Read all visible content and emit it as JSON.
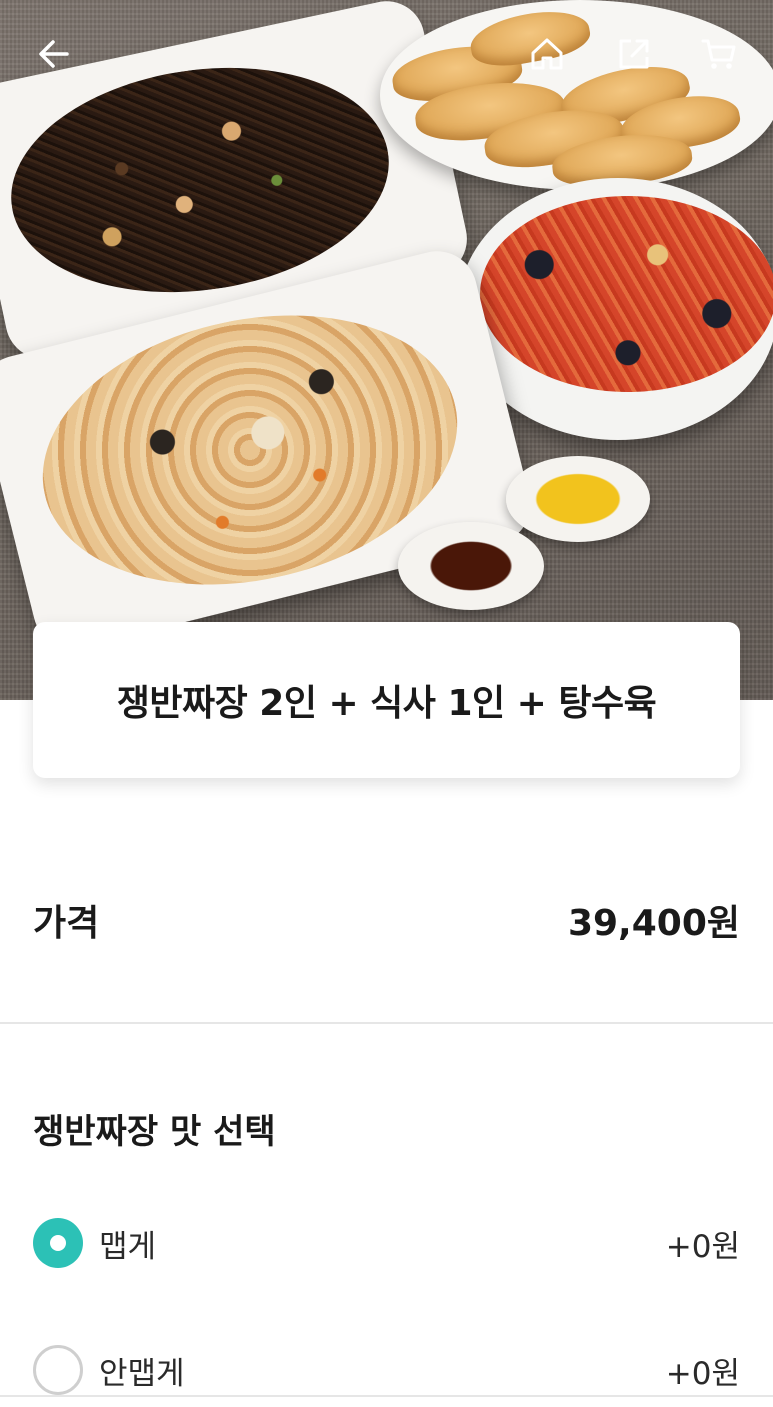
{
  "header": {
    "icons": [
      "back-arrow-icon",
      "home-icon",
      "share-icon",
      "cart-icon"
    ]
  },
  "product": {
    "title": "쟁반짜장 2인 + 식사 1인 + 탕수육"
  },
  "price": {
    "label": "가격",
    "value": "39,400원"
  },
  "options_section": {
    "title": "쟁반짜장 맛 선택",
    "items": [
      {
        "label": "맵게",
        "price": "+0원",
        "selected": true
      },
      {
        "label": "안맵게",
        "price": "+0원",
        "selected": false
      }
    ]
  },
  "colors": {
    "accent": "#2cc1b6"
  }
}
